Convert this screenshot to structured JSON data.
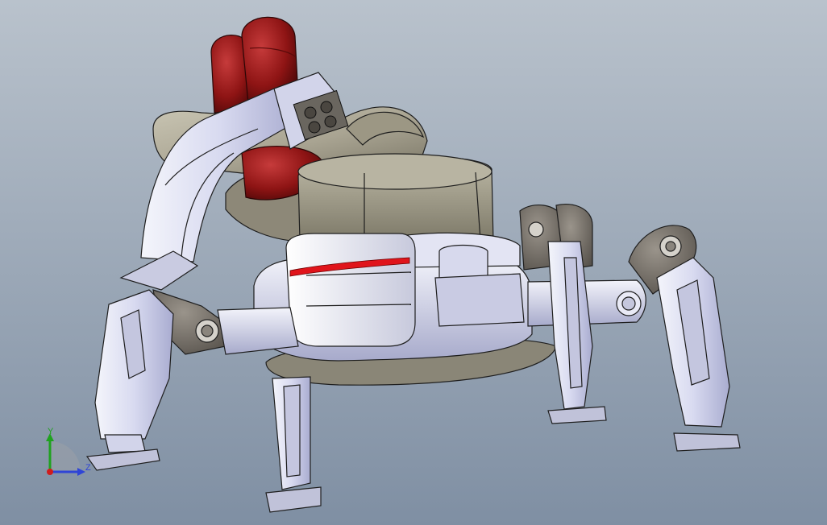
{
  "viewport": {
    "bg_top": "#b9c2cc",
    "bg_bottom": "#7f8fa3"
  },
  "model": {
    "part_colors": {
      "tank_red": "#8e1414",
      "body_tan": "#a9a492",
      "body_tan_dark": "#6f6b5c",
      "leg_lavender": "#d8daf0",
      "leg_lavender_dark": "#a6a9c9",
      "joint_grey": "#6f6a63",
      "stripe_red": "#e0141b",
      "edge": "#1e1e1e"
    }
  },
  "triad": {
    "y_label": "Y",
    "z_label": "Z",
    "y_color": "#1fa21f",
    "z_color": "#2f45d6",
    "origin_color": "#d01c1c"
  }
}
